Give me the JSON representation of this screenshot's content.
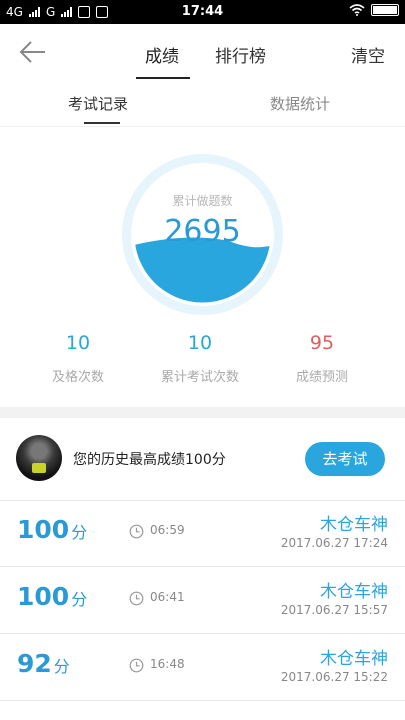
{
  "status_bar": {
    "network_1": "4G",
    "network_2": "G",
    "time": "17:44"
  },
  "nav": {
    "tab_score": "成绩",
    "tab_ranking": "排行榜",
    "clear": "清空"
  },
  "subtabs": {
    "records": "考试记录",
    "stats": "数据统计"
  },
  "gauge": {
    "label": "累计做题数",
    "value": "2695",
    "fill_fraction": 0.42
  },
  "stats": [
    {
      "value": "10",
      "label": "及格次数",
      "color": "#2aa6df"
    },
    {
      "value": "10",
      "label": "累计考试次数",
      "color": "#2aa6df"
    },
    {
      "value": "95",
      "label": "成绩预测",
      "color": "#e35d5d"
    }
  ],
  "best": {
    "text": "您的历史最高成绩100分",
    "button": "去考试"
  },
  "records": [
    {
      "score": "100",
      "unit": "分",
      "duration": "06:59",
      "name": "木仓车神",
      "date": "2017.06.27  17:24"
    },
    {
      "score": "100",
      "unit": "分",
      "duration": "06:41",
      "name": "木仓车神",
      "date": "2017.06.27  15:57"
    },
    {
      "score": "92",
      "unit": "分",
      "duration": "16:48",
      "name": "木仓车神",
      "date": "2017.06.27  15:22"
    }
  ],
  "colors": {
    "accent": "#2aa6df",
    "danger": "#e35d5d"
  }
}
